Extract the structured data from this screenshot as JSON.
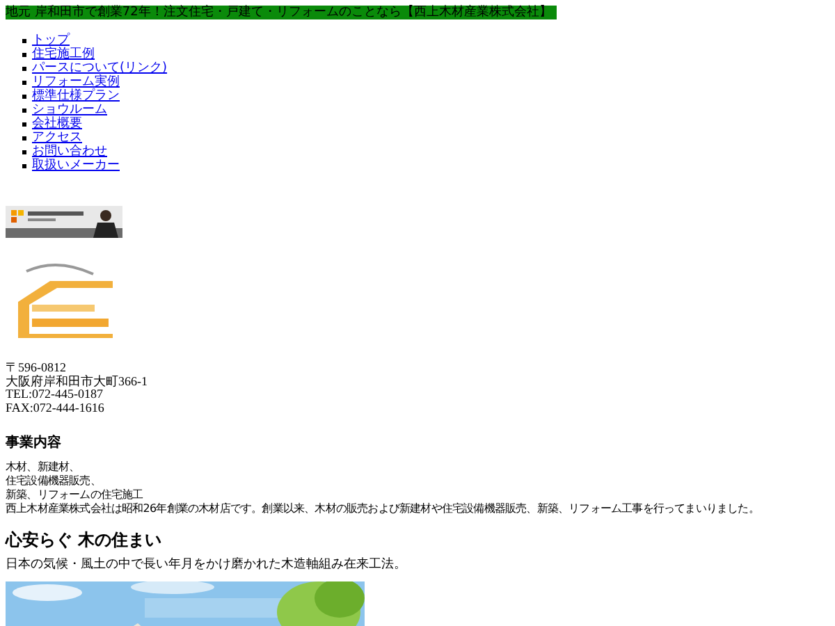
{
  "header": {
    "title": "地元 岸和田市で創業72年！注文住宅・戸建て・リフォームのことなら【西上木材産業株式会社】"
  },
  "nav": {
    "items": [
      "トップ",
      "住宅施工例",
      "パースについて(リンク)",
      "リフォーム実例",
      "標準仕様プラン",
      "ショウルーム",
      "会社概要",
      "アクセス",
      "お問い合わせ",
      "取扱いメーカー"
    ]
  },
  "address": [
    "〒596-0812",
    "大阪府岸和田市大町366-1",
    "TEL:072-445-0187",
    "FAX:072-444-1616"
  ],
  "business": {
    "heading": "事業内容",
    "lines": [
      "木材、新建材、",
      "住宅設備機器販売、",
      "新築、リフォームの住宅施工",
      "西上木材産業株式会社は昭和26年創業の木材店です。創業以来、木材の販売および新建材や住宅設備機器販売、新築、リフォーム工事を行ってまいりました。"
    ]
  },
  "section": {
    "heading": "心安らぐ 木の住まい",
    "text": "日本の気候・風土の中で長い年月をかけ磨かれた木造軸組み在来工法。"
  }
}
